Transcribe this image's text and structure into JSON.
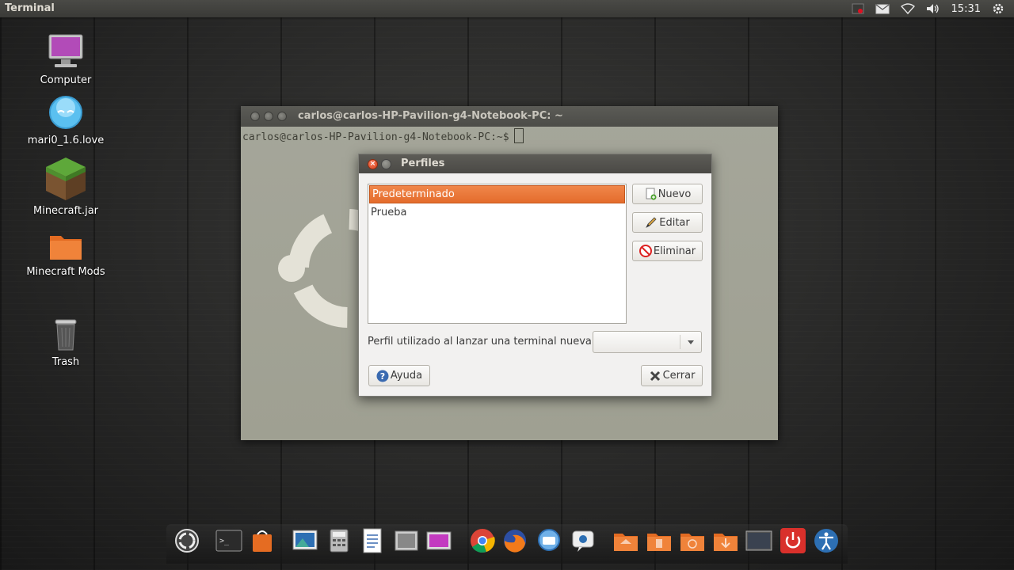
{
  "top_panel": {
    "app_title": "Terminal",
    "clock": "15:31",
    "indicators": [
      "record-icon",
      "mail-icon",
      "wifi-icon",
      "volume-icon",
      "power-gear-icon"
    ]
  },
  "desktop_icons": [
    {
      "name": "desktop-icon-computer",
      "label": "Computer"
    },
    {
      "name": "desktop-icon-mari0",
      "label": "mari0_1.6.love"
    },
    {
      "name": "desktop-icon-minecraft-jar",
      "label": "Minecraft.jar"
    },
    {
      "name": "desktop-icon-minecraft-mods",
      "label": "Minecraft Mods"
    },
    {
      "name": "desktop-icon-trash",
      "label": "Trash"
    }
  ],
  "terminal": {
    "title": "carlos@carlos-HP-Pavilion-g4-Notebook-PC: ~",
    "prompt": "carlos@carlos-HP-Pavilion-g4-Notebook-PC:~$"
  },
  "dialog": {
    "title": "Perfiles",
    "profiles": [
      {
        "label": "Predeterminado",
        "selected": true
      },
      {
        "label": "Prueba",
        "selected": false
      }
    ],
    "buttons": {
      "new": "Nuevo",
      "edit": "Editar",
      "delete": "Eliminar",
      "help": "Ayuda",
      "close": "Cerrar"
    },
    "profile_used_label": "Perfil utilizado al lanzar una terminal nueva:",
    "profile_used_value": ""
  },
  "dock": {
    "items": [
      "ubuntu-settings-icon",
      "terminal-icon",
      "store-bag-icon",
      "image-viewer-icon",
      "calculator-icon",
      "text-editor-icon",
      "photos-icon",
      "video-editor-icon",
      "chrome-icon",
      "firefox-icon",
      "messaging-icon",
      "pidgin-icon",
      "home-folder-icon",
      "documents-folder-icon",
      "recent-folder-icon",
      "downloads-folder-icon",
      "workspace-switcher-icon",
      "shutdown-icon",
      "accessibility-icon"
    ]
  },
  "colors": {
    "selection": "#e9702f",
    "panel": "#3c3b37"
  }
}
